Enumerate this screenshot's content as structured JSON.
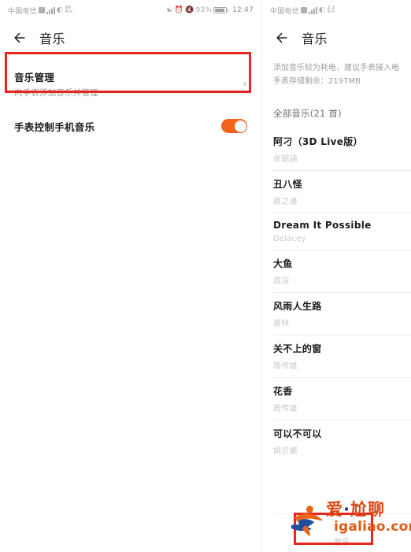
{
  "left_panel": {
    "status_bar": {
      "carrier": "中国电信",
      "network_rate_top": "80",
      "network_rate_bottom": "B/s",
      "battery_percent": "93%",
      "time": "12:47"
    },
    "appbar": {
      "title": "音乐",
      "back_icon": "arrow-left-icon"
    },
    "items": [
      {
        "title": "音乐管理",
        "subtitle": "向手表添加音乐并管理",
        "accessory": "chevron-right-icon",
        "highlighted": true
      },
      {
        "title": "手表控制手机音乐",
        "toggle_state": "on",
        "toggle_color": "#f4631c"
      }
    ]
  },
  "right_panel": {
    "status_bar": {
      "carrier": "中国电信",
      "network_rate_top": "2.1",
      "network_rate_bottom": "K/s"
    },
    "appbar": {
      "title": "音乐",
      "back_icon": "arrow-left-icon"
    },
    "notice": {
      "line1": "添加音乐较为耗电，建议手表接入电",
      "line2": "手表存储剩余：2197MB"
    },
    "section_header": "全部音乐(21 首)",
    "songs": [
      {
        "name": "阿刁（3D Live版）",
        "artist": "张韶涵"
      },
      {
        "name": "丑八怪",
        "artist": "薛之谦"
      },
      {
        "name": "Dream It Possible",
        "artist": "Delacey"
      },
      {
        "name": "大鱼",
        "artist": "周深"
      },
      {
        "name": "风雨人生路",
        "artist": "慕林"
      },
      {
        "name": "关不上的窗",
        "artist": "周传雄"
      },
      {
        "name": "花香",
        "artist": "周传雄"
      },
      {
        "name": "可以不可以",
        "artist": "姚贝娜"
      }
    ],
    "bottom_bar_label": "音乐"
  },
  "watermark": {
    "brand": "爱",
    "dot": "·",
    "brand2": "尬聊",
    "url": "igaliao.com",
    "highlight_color": "#e8241f"
  }
}
